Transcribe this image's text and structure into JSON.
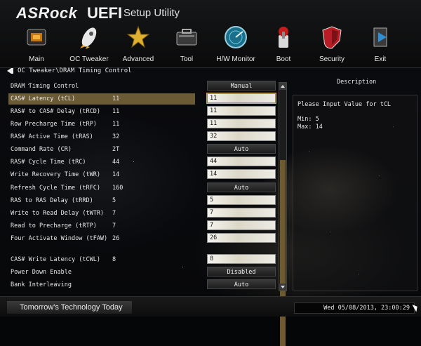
{
  "header": {
    "brand": "ASRock",
    "uefi": "UEFI",
    "subtitle": "Setup Utility"
  },
  "nav": [
    {
      "label": "Main",
      "icon": "main-icon"
    },
    {
      "label": "OC Tweaker",
      "icon": "oc-tweaker-icon"
    },
    {
      "label": "Advanced",
      "icon": "advanced-icon"
    },
    {
      "label": "Tool",
      "icon": "tool-icon"
    },
    {
      "label": "H/W Monitor",
      "icon": "hw-monitor-icon"
    },
    {
      "label": "Boot",
      "icon": "boot-icon"
    },
    {
      "label": "Security",
      "icon": "security-icon"
    },
    {
      "label": "Exit",
      "icon": "exit-icon"
    }
  ],
  "breadcrumb": "OC Tweaker\\DRAM Timing Control",
  "rows": [
    {
      "name": "DRAM Timing Control",
      "current": "",
      "value": "Manual",
      "type": "button"
    },
    {
      "name": "CAS# Latency (tCL)",
      "current": "11",
      "value": "11",
      "type": "input"
    },
    {
      "name": "RAS# to CAS# Delay (tRCD)",
      "current": "11",
      "value": "11",
      "type": "input"
    },
    {
      "name": "Row Precharge Time (tRP)",
      "current": "11",
      "value": "11",
      "type": "input"
    },
    {
      "name": "RAS# Active Time (tRAS)",
      "current": "32",
      "value": "32",
      "type": "input"
    },
    {
      "name": "Command Rate (CR)",
      "current": "2T",
      "value": "Auto",
      "type": "button"
    },
    {
      "name": "RAS# Cycle Time (tRC)",
      "current": "44",
      "value": "44",
      "type": "input"
    },
    {
      "name": "Write Recovery Time (tWR)",
      "current": "14",
      "value": "14",
      "type": "input"
    },
    {
      "name": "Refresh Cycle Time (tRFC)",
      "current": "160",
      "value": "Auto",
      "type": "button"
    },
    {
      "name": "RAS to RAS Delay (tRRD)",
      "current": "5",
      "value": "5",
      "type": "input"
    },
    {
      "name": "Write to Read Delay (tWTR)",
      "current": "7",
      "value": "7",
      "type": "input"
    },
    {
      "name": "Read to Precharge (tRTP)",
      "current": "7",
      "value": "7",
      "type": "input"
    },
    {
      "name": "Four Activate Window (tFAW)",
      "current": "26",
      "value": "26",
      "type": "input"
    },
    {
      "name": "CAS# Write Latency (tCWL)",
      "current": "8",
      "value": "8",
      "type": "input"
    },
    {
      "name": "Power Down Enable",
      "current": "",
      "value": "Disabled",
      "type": "button"
    },
    {
      "name": "Bank Interleaving",
      "current": "",
      "value": "Auto",
      "type": "button"
    }
  ],
  "description": {
    "title": "Description",
    "line1": "Please Input Value for tCL",
    "min": "Min: 5",
    "max": "Max: 14"
  },
  "footer": {
    "tagline": "Tomorrow's Technology Today",
    "datetime": "Wed 05/08/2013, 23:00:29"
  },
  "colors": {
    "accent": "#6b5a36",
    "scroll_thumb": "#6f5a2e"
  }
}
